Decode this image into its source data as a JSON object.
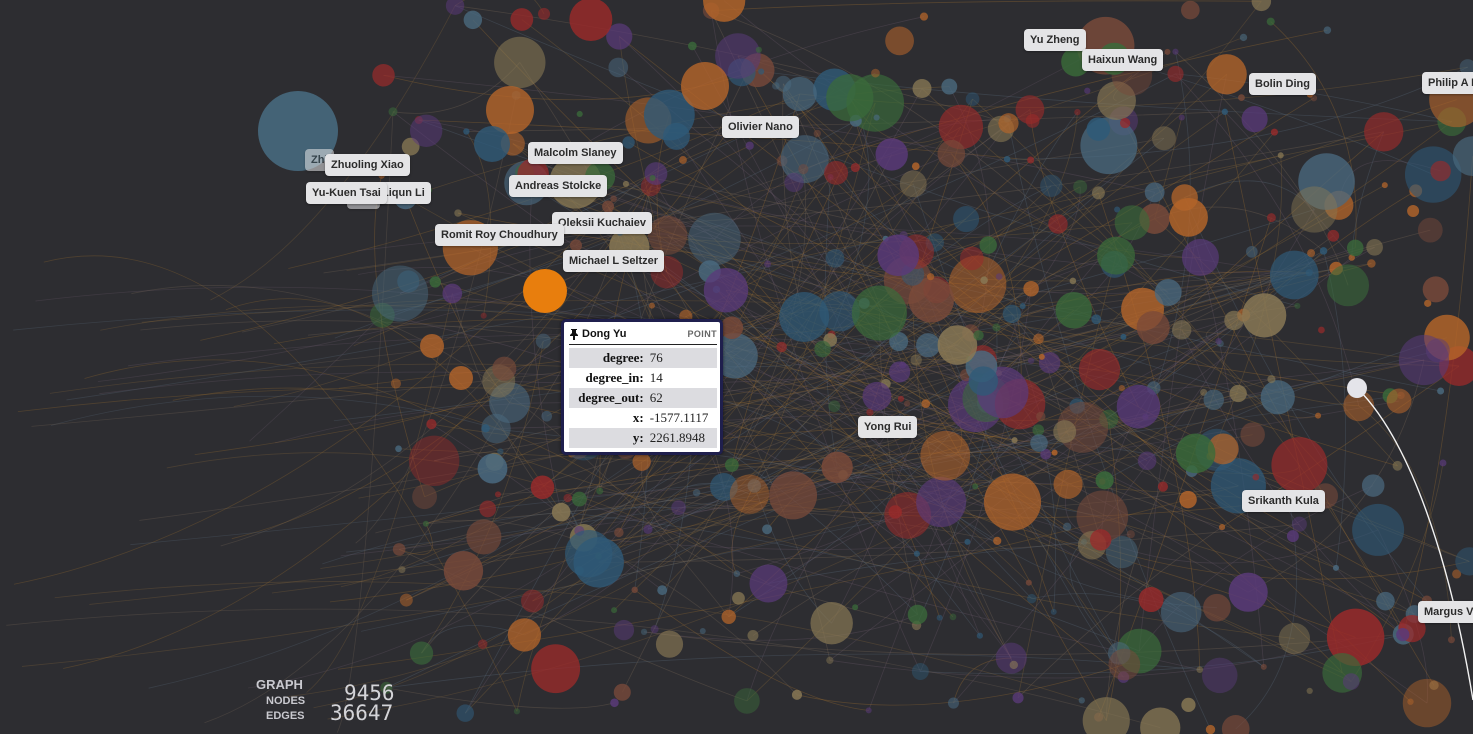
{
  "graph_stats": {
    "section_label": "GRAPH",
    "nodes_label": "NODES",
    "edges_label": "EDGES",
    "nodes_count": "9456",
    "edges_count": "36647"
  },
  "node_labels": [
    "Yu Zheng",
    "Haixun Wang",
    "Bolin Ding",
    "Philip A B",
    "Olivier Nano",
    "Malcolm Slaney",
    "Andreas Stolcke",
    "Oleksii Kuchaiev",
    "Romit Roy Choudhury",
    "Michael L Seltzer",
    "Zhuoling Xiao",
    "Zhi",
    "Yu-Kuen Tsai",
    "Liqun Li",
    "Sou",
    "Yong Rui",
    "Srikanth Kula",
    "Margus Ve"
  ],
  "tooltip": {
    "title": "Dong Yu",
    "kind": "POINT",
    "pin_icon": "pin-icon",
    "rows": [
      {
        "key": "degree:",
        "value": "76"
      },
      {
        "key": "degree_in:",
        "value": "14"
      },
      {
        "key": "degree_out:",
        "value": "62"
      },
      {
        "key": "x:",
        "value": "-1577.1117"
      },
      {
        "key": "y:",
        "value": "2261.8948"
      }
    ]
  },
  "colors": {
    "background": "#2d2d31",
    "selected_node": "#e87e0d",
    "palette": [
      "#9a2a2a",
      "#b5652a",
      "#2f5a78",
      "#3a6b3a",
      "#5a3a7a",
      "#8a7a55",
      "#7a4a3a",
      "#4a6a80"
    ]
  }
}
